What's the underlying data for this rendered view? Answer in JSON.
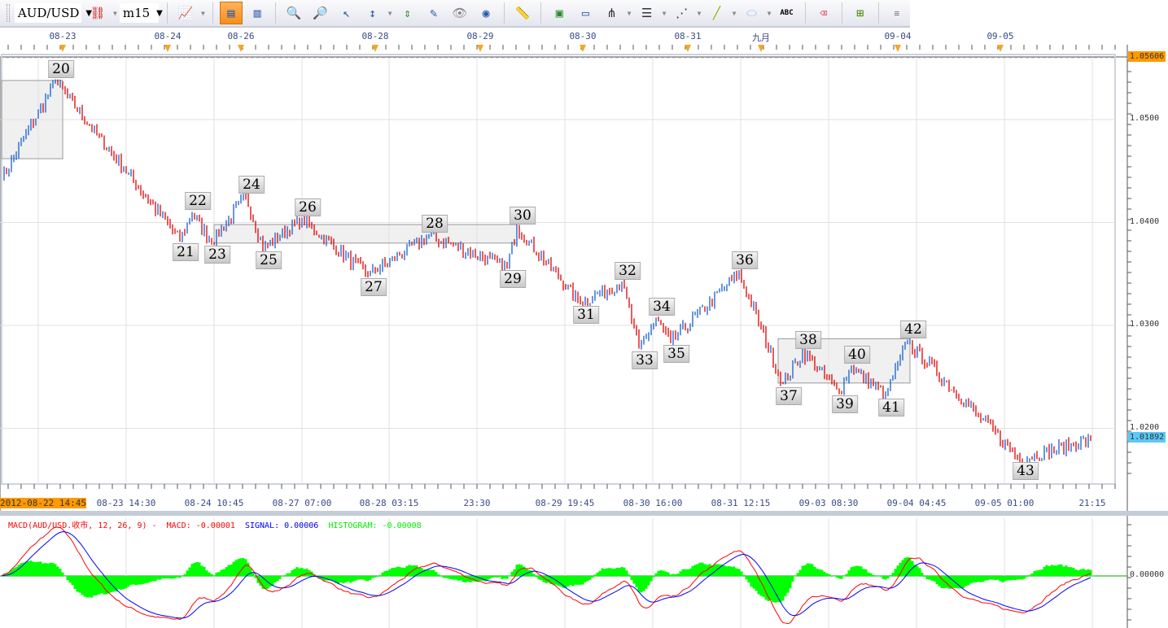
{
  "toolbar": {
    "symbol": "AUD/USD",
    "timeframe": "m15",
    "abc_label": "ABC",
    "icons": [
      "chart-type-icon",
      "bar-chart-icon",
      "candle-chart-icon",
      "zoom-in-icon",
      "zoom-out-icon",
      "cursor-icon",
      "vertical-zoom-icon",
      "period-separator-icon",
      "properties-icon",
      "view-icon",
      "globe-icon",
      "ruler-icon",
      "add-image-icon",
      "window-icon",
      "pitchfork-icon",
      "fibonacci-icon",
      "fan-icon",
      "trendline-icon",
      "ellipse-icon",
      "text-icon",
      "eraser-icon",
      "hierarchy-icon",
      "more-icon"
    ]
  },
  "top_dates": [
    {
      "t": "08-23",
      "bar": 25
    },
    {
      "t": "08-24",
      "bar": 68
    },
    {
      "t": "08-26",
      "bar": 98
    },
    {
      "t": "08-28",
      "bar": 153
    },
    {
      "t": "08-29",
      "bar": 196
    },
    {
      "t": "08-30",
      "bar": 238
    },
    {
      "t": "08-31",
      "bar": 281
    },
    {
      "t": "九月",
      "bar": 311
    },
    {
      "t": "09-04",
      "bar": 367
    },
    {
      "t": "09-05",
      "bar": 409
    }
  ],
  "price_axis": {
    "ticks": [
      "1.0500",
      "1.0400",
      "1.0300",
      "1.0200"
    ],
    "ceiling_price": "1.05606",
    "current_price": "1.01892",
    "accent": "#ff9900",
    "current_color": "#5bc8f5"
  },
  "time_axis": [
    "2012-08-22 14:45",
    "08-23 14:30",
    "08-24 10:45",
    "08-27 07:00",
    "08-28 03:15",
    "23:30",
    "08-29 19:45",
    "08-30 16:00",
    "08-31 12:15",
    "09-03 08:30",
    "09-04 04:45",
    "09-05 01:00",
    "21:15"
  ],
  "waves": [
    {
      "label": "",
      "bar": 0,
      "price": 1.0442
    },
    {
      "label": "20",
      "bar": 22,
      "price": 1.0537,
      "pos": "above"
    },
    {
      "label": "21",
      "bar": 73,
      "price": 1.0383,
      "pos": "below"
    },
    {
      "label": "22",
      "bar": 78,
      "price": 1.0409,
      "pos": "above"
    },
    {
      "label": "23",
      "bar": 86,
      "price": 1.0381,
      "pos": "below"
    },
    {
      "label": "24",
      "bar": 100,
      "price": 1.0425,
      "pos": "above"
    },
    {
      "label": "25",
      "bar": 107,
      "price": 1.0375,
      "pos": "below"
    },
    {
      "label": "26",
      "bar": 123,
      "price": 1.0403,
      "pos": "above"
    },
    {
      "label": "27",
      "bar": 150,
      "price": 1.0349,
      "pos": "below"
    },
    {
      "label": "28",
      "bar": 175,
      "price": 1.0387,
      "pos": "above"
    },
    {
      "label": "29",
      "bar": 207,
      "price": 1.0357,
      "pos": "below"
    },
    {
      "label": "30",
      "bar": 211,
      "price": 1.0395,
      "pos": "above"
    },
    {
      "label": "31",
      "bar": 237,
      "price": 1.0322,
      "pos": "below"
    },
    {
      "label": "32",
      "bar": 254,
      "price": 1.0341,
      "pos": "above"
    },
    {
      "label": "33",
      "bar": 261,
      "price": 1.0278,
      "pos": "below"
    },
    {
      "label": "34",
      "bar": 268,
      "price": 1.0306,
      "pos": "above"
    },
    {
      "label": "35",
      "bar": 274,
      "price": 1.0284,
      "pos": "below"
    },
    {
      "label": "36",
      "bar": 302,
      "price": 1.0351,
      "pos": "above"
    },
    {
      "label": "37",
      "bar": 320,
      "price": 1.0243,
      "pos": "below"
    },
    {
      "label": "38",
      "bar": 328,
      "price": 1.0274,
      "pos": "above"
    },
    {
      "label": "39",
      "bar": 343,
      "price": 1.0235,
      "pos": "below"
    },
    {
      "label": "40",
      "bar": 348,
      "price": 1.026,
      "pos": "above"
    },
    {
      "label": "41",
      "bar": 362,
      "price": 1.0232,
      "pos": "below"
    },
    {
      "label": "42",
      "bar": 371,
      "price": 1.0284,
      "pos": "above"
    },
    {
      "label": "43",
      "bar": 417,
      "price": 1.017,
      "pos": "below"
    },
    {
      "label": "",
      "bar": 446,
      "price": 1.0189
    }
  ],
  "boxes": [
    {
      "from": 0,
      "to": 25,
      "low": 1.0462,
      "high": 1.0538
    },
    {
      "from": 87,
      "to": 211,
      "low": 1.038,
      "high": 1.0398
    },
    {
      "from": 318,
      "to": 372,
      "low": 1.0244,
      "high": 1.0287
    }
  ],
  "macd": {
    "header": "MACD(AUD/USD.收市, 12, 26, 9) - ",
    "macd_label": "MACD: -0.00001",
    "signal_label": "SIGNAL: 0.00006",
    "histogram_label": "HISTOGRAM: -0.00008",
    "zero_label": "0.00000",
    "macd_color": "#ff0000",
    "signal_color": "#0000ff",
    "hist_color": "#00ff00"
  }
}
